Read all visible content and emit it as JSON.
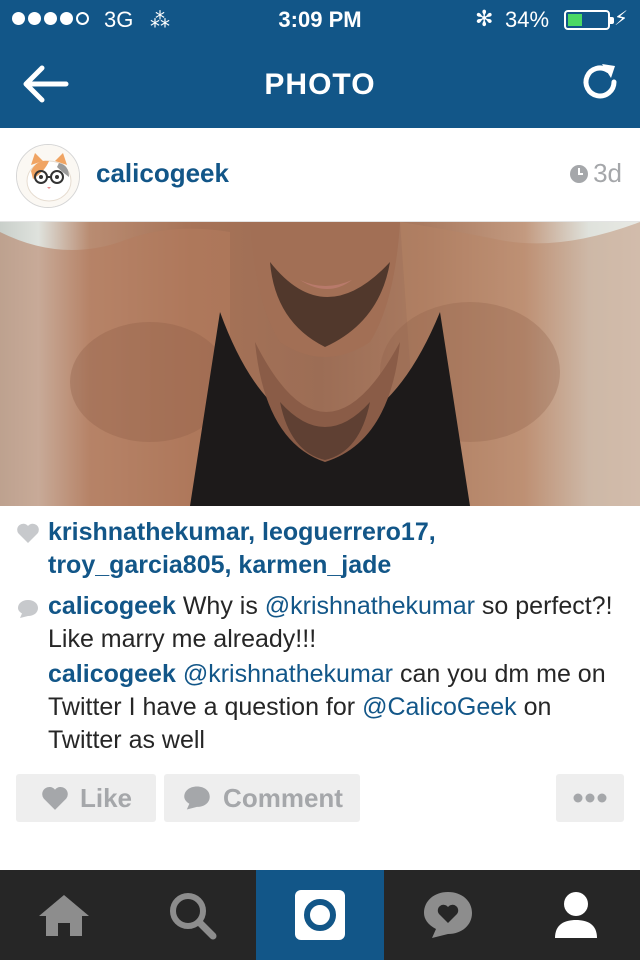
{
  "status_bar": {
    "network": "3G",
    "time": "3:09 PM",
    "battery_percent": "34%",
    "battery_level": 0.34
  },
  "nav": {
    "title": "PHOTO",
    "back_icon": "back-arrow-icon",
    "refresh_icon": "refresh-icon"
  },
  "post": {
    "username": "calicogeek",
    "time_ago": "3d"
  },
  "likes": {
    "users": [
      "krishnathekumar",
      "leoguerrero17",
      "troy_garcia805",
      "karmen_jade"
    ]
  },
  "comments": [
    {
      "user": "calicogeek",
      "mention": "@krishnathekumar",
      "text_before": "Why is",
      "text_after": "so perfect?! Like marry me already!!!"
    },
    {
      "user": "calicogeek",
      "mention": "@krishnathekumar",
      "text_after": "can you dm me on Twitter I have a question for",
      "mention2": "@CalicoGeek",
      "text_end": "on Twitter as well"
    }
  ],
  "actions": {
    "like_label": "Like",
    "comment_label": "Comment"
  },
  "colors": {
    "brand": "#125688",
    "tabbar": "#262626",
    "muted": "#a5a7aa"
  },
  "tabs": [
    "home",
    "search",
    "camera",
    "activity",
    "profile"
  ]
}
